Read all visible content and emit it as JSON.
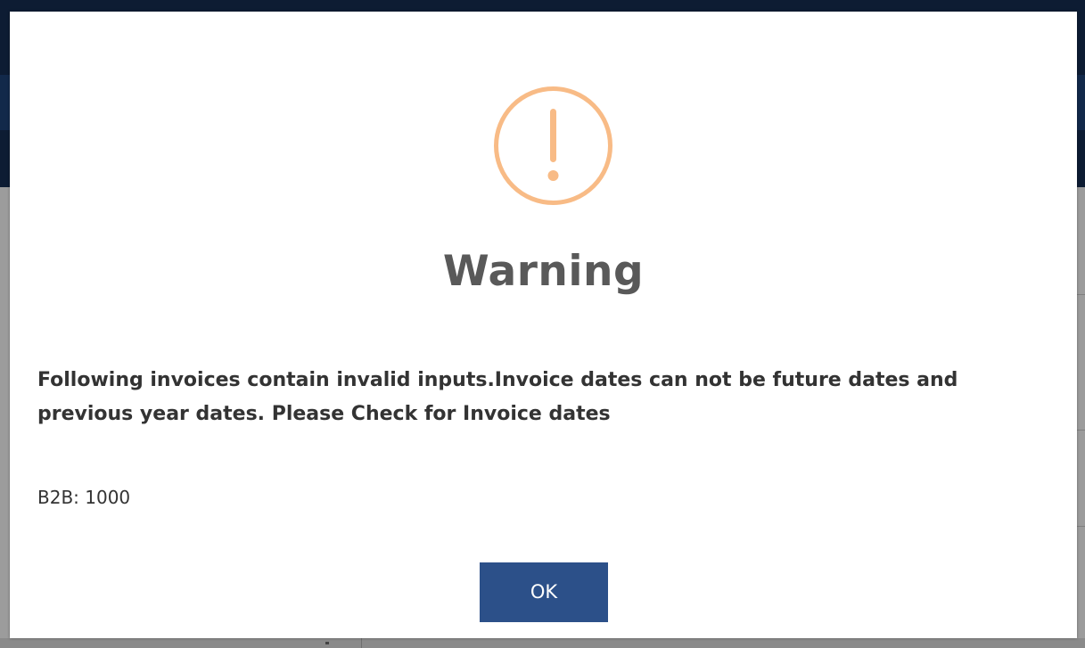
{
  "dialog": {
    "icon": "exclamation-circle-icon",
    "icon_color": "#f8bb86",
    "title": "Warning",
    "message": "Following invoices contain invalid inputs.Invoice dates can not be future dates and previous year dates. Please Check for Invoice dates",
    "detail": "B2B: 1000",
    "ok_label": "OK",
    "ok_color": "#2c5089"
  }
}
